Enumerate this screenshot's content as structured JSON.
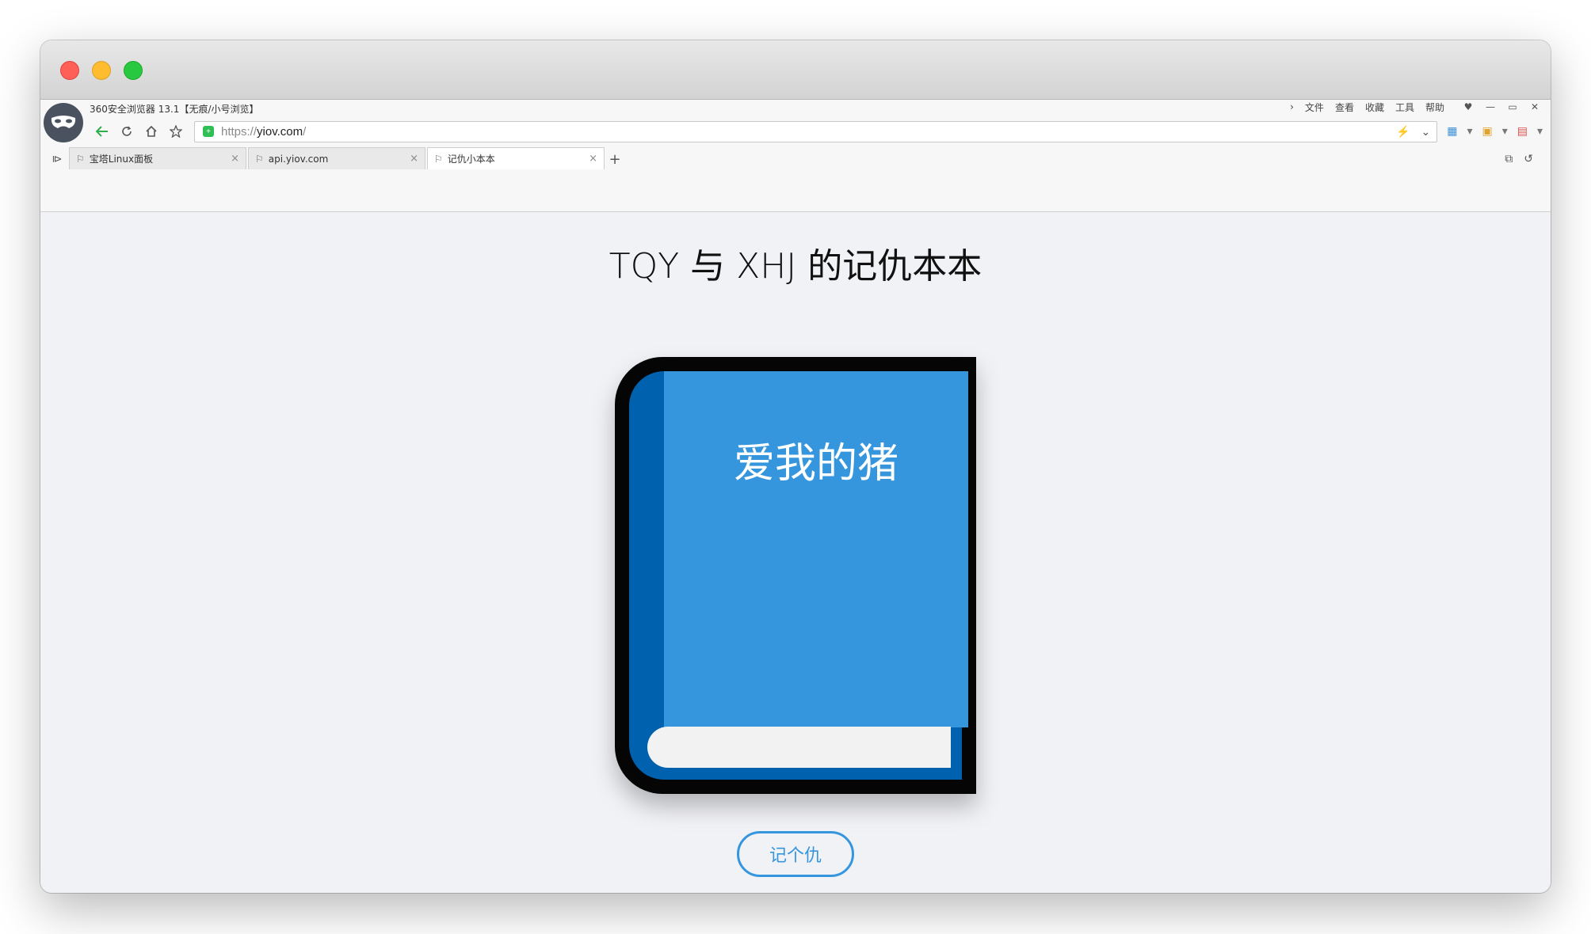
{
  "browser": {
    "app_title": "360安全浏览器 13.1【无痕/小号浏览】",
    "menu": [
      "文件",
      "查看",
      "收藏",
      "工具",
      "帮助"
    ],
    "address": {
      "scheme": "https://",
      "host": "yiov.com",
      "path": "/"
    },
    "tabs": [
      {
        "label": "宝塔Linux面板",
        "active": false
      },
      {
        "label": "api.yiov.com",
        "active": false
      },
      {
        "label": "记仇小本本",
        "active": true
      }
    ]
  },
  "page": {
    "title": "TQY 与 XHJ 的记仇本本",
    "book_title": "爱我的猪",
    "button_label": "记个仇"
  },
  "colors": {
    "accent": "#3595dd",
    "book_spine": "#0062af",
    "book_border": "#050505",
    "book_pages": "#f2f2f2",
    "secure_green": "#2fbf55"
  }
}
